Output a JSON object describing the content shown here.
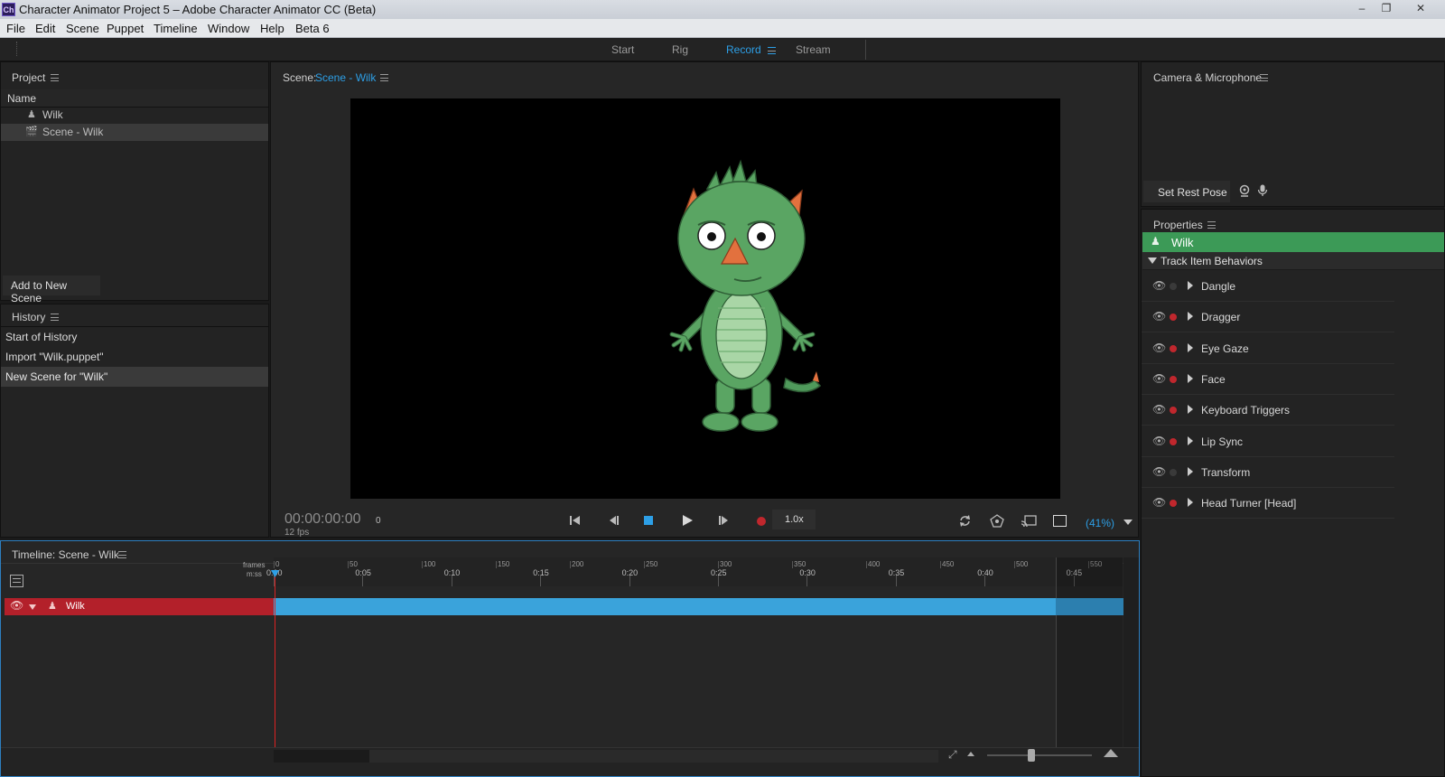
{
  "window": {
    "title": "Character Animator Project 5 – Adobe Character Animator CC (Beta)",
    "app_icon": "Ch",
    "controls": [
      "–",
      "❐",
      "✕"
    ]
  },
  "menu": [
    "File",
    "Edit",
    "Scene",
    "Puppet",
    "Timeline",
    "Window",
    "Help",
    "Beta 6"
  ],
  "workspaces": {
    "start": "Start",
    "rig": "Rig",
    "record": "Record",
    "stream": "Stream",
    "active": "Record"
  },
  "project": {
    "title": "Project",
    "column_name": "Name",
    "items": [
      {
        "label": "Wilk",
        "icon": "puppet-icon"
      },
      {
        "label": "Scene - Wilk",
        "icon": "scene-icon",
        "selected": true
      }
    ],
    "add_to_scene": "Add to New Scene"
  },
  "history": {
    "title": "History",
    "items": [
      "Start of History",
      "Import \"Wilk.puppet\"",
      "New Scene for \"Wilk\""
    ],
    "selected_index": 2
  },
  "scene": {
    "label": "Scene:",
    "name": "Scene - Wilk",
    "timecode": "00:00:00:00",
    "frame": "0",
    "fps": "12 fps",
    "speed": "1.0x",
    "zoom": "(41%)"
  },
  "camera": {
    "title": "Camera & Microphone",
    "set_rest_pose": "Set Rest Pose"
  },
  "properties": {
    "title": "Properties",
    "puppet": "Wilk",
    "section": "Track Item Behaviors",
    "behaviors": [
      {
        "name": "Dangle",
        "armed": false
      },
      {
        "name": "Dragger",
        "armed": true
      },
      {
        "name": "Eye Gaze",
        "armed": true
      },
      {
        "name": "Face",
        "armed": true
      },
      {
        "name": "Keyboard Triggers",
        "armed": true
      },
      {
        "name": "Lip Sync",
        "armed": true
      },
      {
        "name": "Transform",
        "armed": false
      },
      {
        "name": "Head Turner [Head]",
        "armed": true
      }
    ]
  },
  "timeline": {
    "title": "Timeline: Scene - Wilk",
    "frames_label": "frames",
    "mss_label": "m:ss",
    "frame_ticks": [
      "0",
      "50",
      "100",
      "150",
      "200",
      "250",
      "300",
      "350",
      "400",
      "450",
      "500",
      "550"
    ],
    "time_ticks": [
      "0:00",
      "0:05",
      "0:10",
      "0:15",
      "0:20",
      "0:25",
      "0:30",
      "0:35",
      "0:40",
      "0:45"
    ],
    "track": {
      "name": "Wilk"
    }
  },
  "colors": {
    "accent": "#2d9fe6",
    "track_red": "#b3202a",
    "track_bar": "#3aa3db",
    "puppet_green": "#3c9a57"
  }
}
